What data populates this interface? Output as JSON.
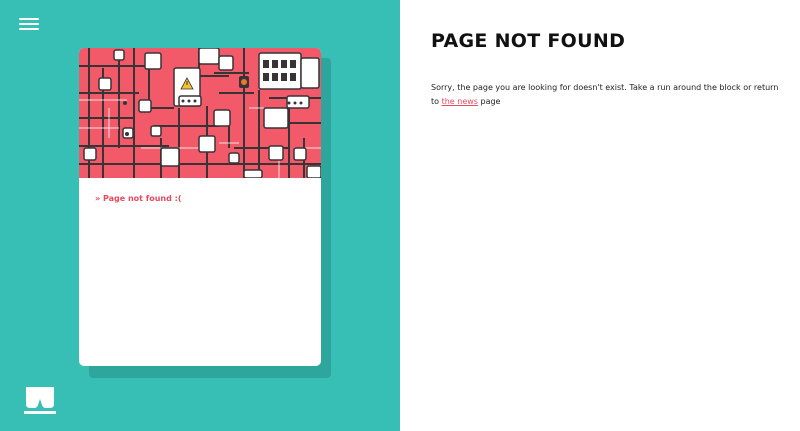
{
  "sidebar": {
    "menu_icon": "hamburger-menu-icon",
    "logo_icon": "w-logo-icon",
    "background_color": "#37bfb5"
  },
  "card": {
    "image": "circuit-board-illustration",
    "caption": "» Page not found :(",
    "accent_color": "#e84a5f"
  },
  "main": {
    "title": "PAGE NOT FOUND",
    "message_before": "Sorry, the page you are looking for doesn't exist. Take a run around the block or return to ",
    "link_text": "the news",
    "message_after": " page"
  }
}
